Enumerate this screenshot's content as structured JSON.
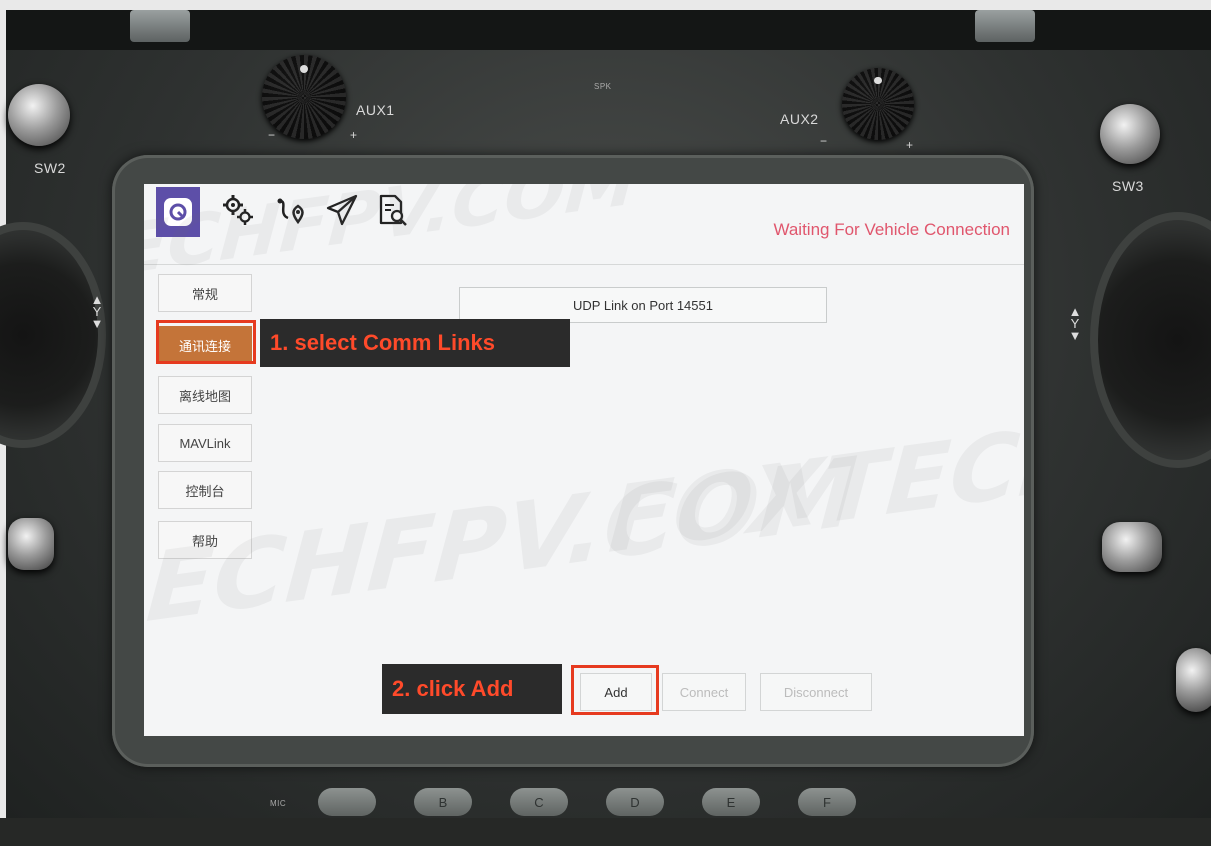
{
  "hardware": {
    "labels": {
      "sw2": "SW2",
      "sw3": "SW3",
      "aux1": "AUX1",
      "aux2": "AUX2",
      "spk": "SPK",
      "mic": "MIC",
      "y1": "Y",
      "y2": "Y"
    },
    "buttons": [
      {
        "label": ""
      },
      {
        "label": "B"
      },
      {
        "label": "C"
      },
      {
        "label": "D"
      },
      {
        "label": "E"
      },
      {
        "label": "F"
      }
    ]
  },
  "toolbar": {
    "icons": [
      "app-logo-icon",
      "settings-gears-icon",
      "plan-route-icon",
      "fly-send-icon",
      "analyze-document-icon"
    ],
    "status": "Waiting For Vehicle Connection",
    "status_color": "#e0566d"
  },
  "sidebar": {
    "items": [
      {
        "label": "常规"
      },
      {
        "label": "通讯连接",
        "active": true
      },
      {
        "label": "离线地图"
      },
      {
        "label": "MAVLink"
      },
      {
        "label": "控制台"
      },
      {
        "label": "帮助"
      }
    ],
    "active_color": "#c47439"
  },
  "links": {
    "items": [
      {
        "label": "UDP Link on Port 14551"
      }
    ]
  },
  "actions": {
    "add": "Add",
    "connect": "Connect",
    "disconnect": "Disconnect"
  },
  "annotations": {
    "step1": "1. select Comm Links",
    "step2": "2. click Add",
    "color": "#e63a1f"
  },
  "watermark": {
    "line1": "ECHFPV.COM",
    "line2": "ECHFPV.COM",
    "line3": "FOXTECH"
  }
}
